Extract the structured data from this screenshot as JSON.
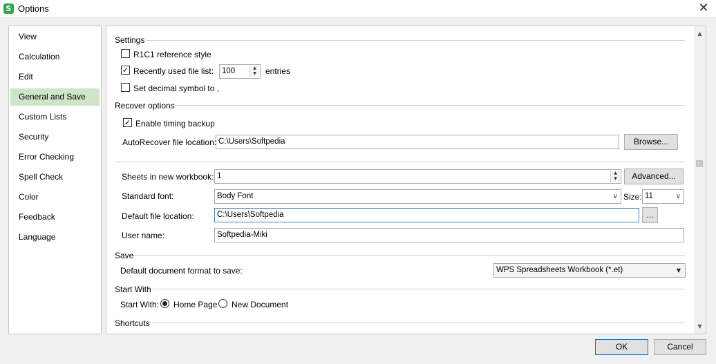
{
  "window": {
    "title": "Options",
    "app_icon_glyph": "S"
  },
  "sidebar": {
    "items": [
      {
        "label": "View"
      },
      {
        "label": "Calculation"
      },
      {
        "label": "Edit"
      },
      {
        "label": "General and Save",
        "active": true
      },
      {
        "label": "Custom Lists"
      },
      {
        "label": "Security"
      },
      {
        "label": "Error Checking"
      },
      {
        "label": "Spell Check"
      },
      {
        "label": "Color"
      },
      {
        "label": "Feedback"
      },
      {
        "label": "Language"
      }
    ]
  },
  "settings": {
    "title": "Settings",
    "r1c1_label": "R1C1 reference style",
    "r1c1_checked": false,
    "recent_files_label": "Recently used file list:",
    "recent_files_checked": true,
    "recent_files_value": "100",
    "recent_files_suffix": "entries",
    "decimal_label": "Set decimal symbol to ,",
    "decimal_checked": false
  },
  "recover": {
    "title": "Recover options",
    "timing_backup_label": "Enable timing backup",
    "timing_backup_checked": true,
    "autorecover_label": "AutoRecover file location:",
    "autorecover_value": "C:\\Users\\Softpedia",
    "browse_label": "Browse..."
  },
  "general": {
    "sheets_label": "Sheets in new workbook:",
    "sheets_value": "1",
    "advanced_label": "Advanced...",
    "font_label": "Standard font:",
    "font_value": "Body Font",
    "size_label": "Size:",
    "size_value": "11",
    "file_location_label": "Default file location:",
    "file_location_value": "C:\\Users\\Softpedia",
    "file_location_button": "...",
    "username_label": "User name:",
    "username_value": "Softpedia-Miki"
  },
  "save": {
    "title": "Save",
    "format_label": "Default document format to save:",
    "format_value": "WPS Spreadsheets Workbook (*.et)"
  },
  "start_with": {
    "title": "Start With",
    "label": "Start With:",
    "options": [
      {
        "label": "Home Page",
        "selected": true
      },
      {
        "label": "New Document",
        "selected": false
      }
    ]
  },
  "shortcuts": {
    "title": "Shortcuts"
  },
  "footer": {
    "ok_label": "OK",
    "cancel_label": "Cancel"
  },
  "colors": {
    "active_nav": "#cfe5c9",
    "app_icon": "#2fa84f",
    "ok_border": "#0078d7"
  }
}
